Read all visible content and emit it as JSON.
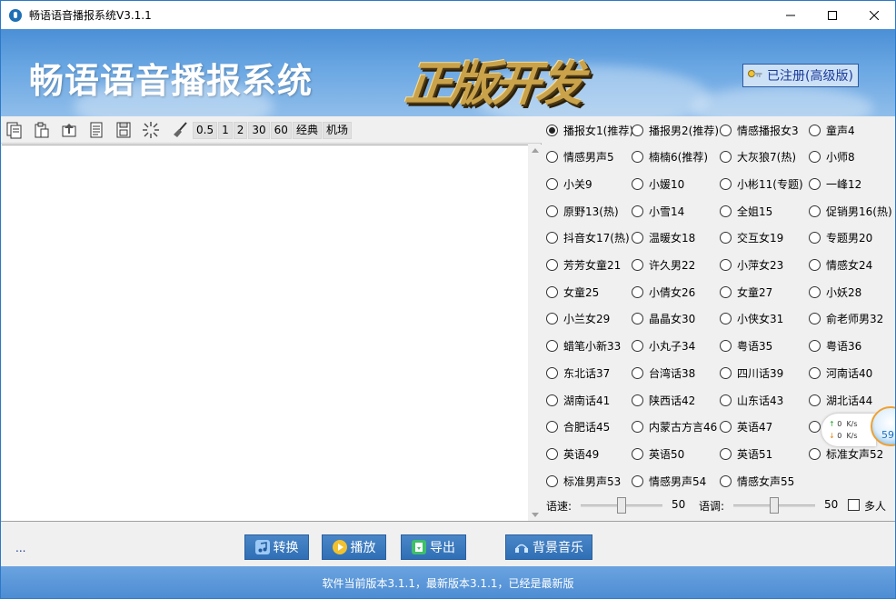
{
  "window": {
    "title": "畅语语音播报系统V3.1.1"
  },
  "banner": {
    "title": "畅语语音播报系统",
    "badge": "正版开发",
    "register_label": "已注册(高级版)"
  },
  "toolbar": {
    "icons": [
      "new-doc-icon",
      "paste-icon",
      "import-icon",
      "text-doc-icon",
      "save-icon",
      "sparkle-icon",
      "broom-icon"
    ],
    "speed_buttons": [
      "0.5",
      "1",
      "2",
      "30",
      "60",
      "经典",
      "机场"
    ]
  },
  "voices": [
    "播报女1(推荐)",
    "播报男2(推荐)",
    "情感播报女3",
    "童声4",
    "情感男声5",
    "楠楠6(推荐)",
    "大灰狼7(热)",
    "小师8",
    "小关9",
    "小媛10",
    "小彬11(专题)",
    "一峰12",
    "原野13(热)",
    "小雪14",
    "全姐15",
    "促销男16(热)",
    "抖音女17(热)",
    "温暖女18",
    "交互女19",
    "专题男20",
    "芳芳女童21",
    "许久男22",
    "小萍女23",
    "情感女24",
    "女童25",
    "小倩女26",
    "女童27",
    "小妖28",
    "小兰女29",
    "晶晶女30",
    "小侠女31",
    "俞老师男32",
    "蜡笔小新33",
    "小丸子34",
    "粤语35",
    "粤语36",
    "东北话37",
    "台湾话38",
    "四川话39",
    "河南话40",
    "湖南话41",
    "陕西话42",
    "山东话43",
    "湖北话44",
    "合肥话45",
    "内蒙古方言46",
    "英语47",
    "",
    "英语49",
    "英语50",
    "英语51",
    "标准女声52",
    "标准男声53",
    "情感男声54",
    "情感女声55"
  ],
  "selected_voice": "播报女1(推荐)",
  "controls": {
    "speed_label": "语速:",
    "speed_value": "50",
    "pitch_label": "语调:",
    "pitch_value": "50",
    "multi_label": "多人",
    "speed_level": 0.5,
    "pitch_level": 0.5
  },
  "net_widget": {
    "up": "0",
    "down": "0",
    "unit": "K/s",
    "percent": "59"
  },
  "actions": {
    "convert": "转换",
    "play": "播放",
    "export": "导出",
    "bgm": "背景音乐"
  },
  "status": {
    "left_text": "...",
    "footer": "软件当前版本3.1.1，最新版本3.1.1，已经是最新版"
  },
  "colors": {
    "accent": "#2f6fb5",
    "banner_top": "#4b8fd6",
    "footer": "#5b97d9",
    "badge_gold": "#c9a24a"
  }
}
